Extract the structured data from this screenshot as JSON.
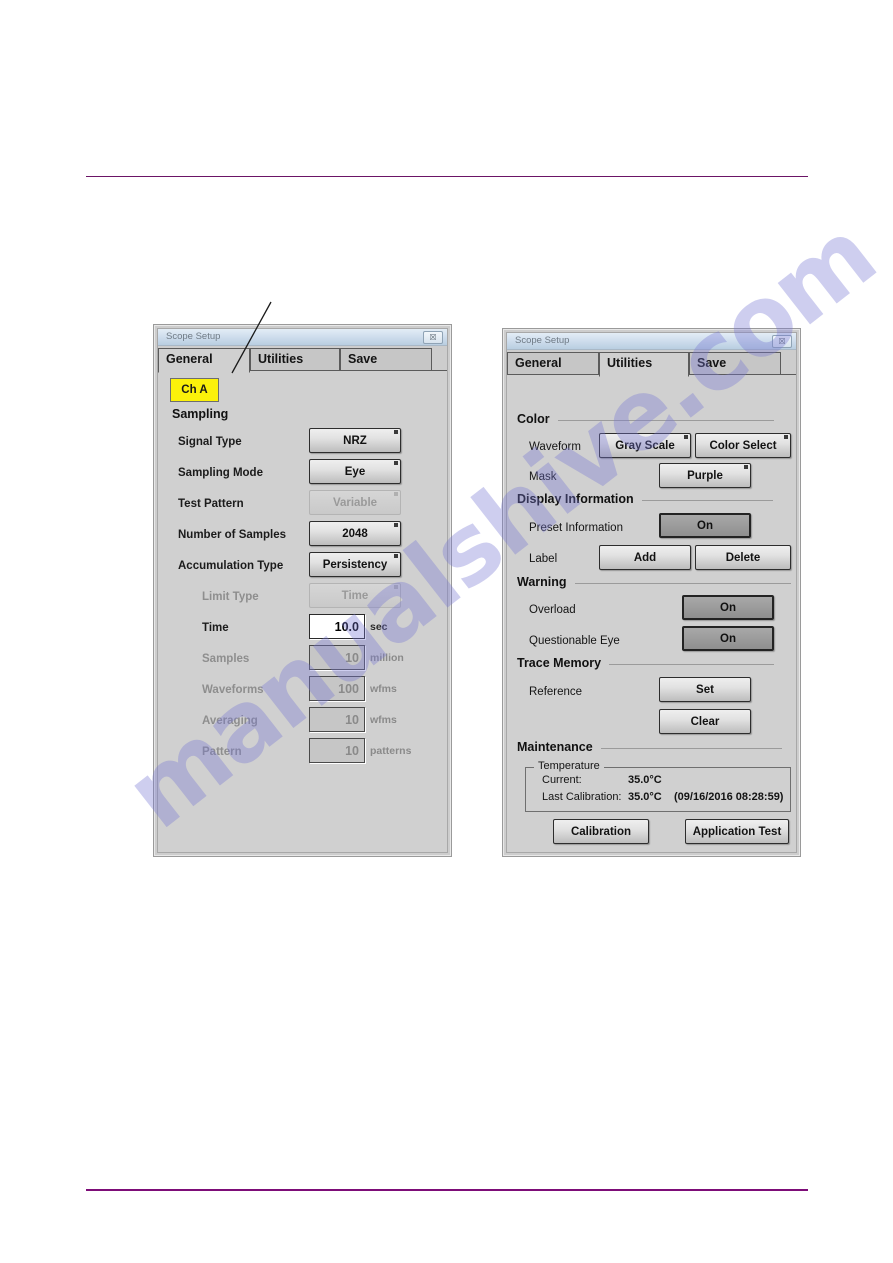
{
  "page": {
    "watermark": "manualshive.com",
    "rule_color": "#6b1466"
  },
  "callout": {
    "name": "callout-leader-line"
  },
  "dialog_general": {
    "titlebar": {
      "title": "Scope Setup",
      "close_glyph": "☒"
    },
    "tabs": [
      {
        "label": "General",
        "active": true
      },
      {
        "label": "Utilities",
        "active": false
      },
      {
        "label": "Save",
        "active": false
      }
    ],
    "channel_chip": "Ch A",
    "section": "Sampling",
    "rows": [
      {
        "label": "Signal Type",
        "control": "button",
        "value": "NRZ",
        "enabled": true
      },
      {
        "label": "Sampling Mode",
        "control": "button",
        "value": "Eye",
        "enabled": true
      },
      {
        "label": "Test Pattern",
        "control": "button",
        "value": "Variable",
        "enabled": false
      },
      {
        "label": "Number of Samples",
        "control": "button",
        "value": "2048",
        "enabled": true
      },
      {
        "label": "Accumulation Type",
        "control": "button",
        "value": "Persistency",
        "enabled": true
      },
      {
        "label": "Limit Type",
        "control": "button",
        "value": "Time",
        "enabled": false
      },
      {
        "label": "Time",
        "control": "field",
        "value": "10.0",
        "unit": "sec",
        "enabled": true
      },
      {
        "label": "Samples",
        "control": "field",
        "value": "10",
        "unit": "million",
        "enabled": false
      },
      {
        "label": "Waveforms",
        "control": "field",
        "value": "100",
        "unit": "wfms",
        "enabled": false
      },
      {
        "label": "Averaging",
        "control": "field",
        "value": "10",
        "unit": "wfms",
        "enabled": false
      },
      {
        "label": "Pattern",
        "control": "field",
        "value": "10",
        "unit": "patterns",
        "enabled": false
      }
    ]
  },
  "dialog_utilities": {
    "titlebar": {
      "title": "Scope Setup",
      "close_glyph": "☒"
    },
    "tabs": [
      {
        "label": "General",
        "active": false
      },
      {
        "label": "Utilities",
        "active": true
      },
      {
        "label": "Save",
        "active": false
      }
    ],
    "sections": {
      "color": {
        "heading": "Color",
        "waveform_label": "Waveform",
        "waveform_buttons": [
          "Gray Scale",
          "Color Select"
        ],
        "mask_label": "Mask",
        "mask_button": "Purple"
      },
      "display_information": {
        "heading": "Display Information",
        "preset_label": "Preset Information",
        "preset_value": "On",
        "label_label": "Label",
        "label_buttons": [
          "Add",
          "Delete"
        ]
      },
      "warning": {
        "heading": "Warning",
        "overload_label": "Overload",
        "overload_value": "On",
        "questionable_label": "Questionable Eye",
        "questionable_value": "On"
      },
      "trace_memory": {
        "heading": "Trace Memory",
        "reference_label": "Reference",
        "set_button": "Set",
        "clear_button": "Clear"
      },
      "maintenance": {
        "heading": "Maintenance",
        "group_title": "Temperature",
        "current_label": "Current:",
        "current_value": "35.0°C",
        "last_cal_label": "Last Calibration:",
        "last_cal_value": "35.0°C",
        "last_cal_time": "(09/16/2016 08:28:59)",
        "calibration_button": "Calibration",
        "application_test_button": "Application Test"
      }
    }
  }
}
